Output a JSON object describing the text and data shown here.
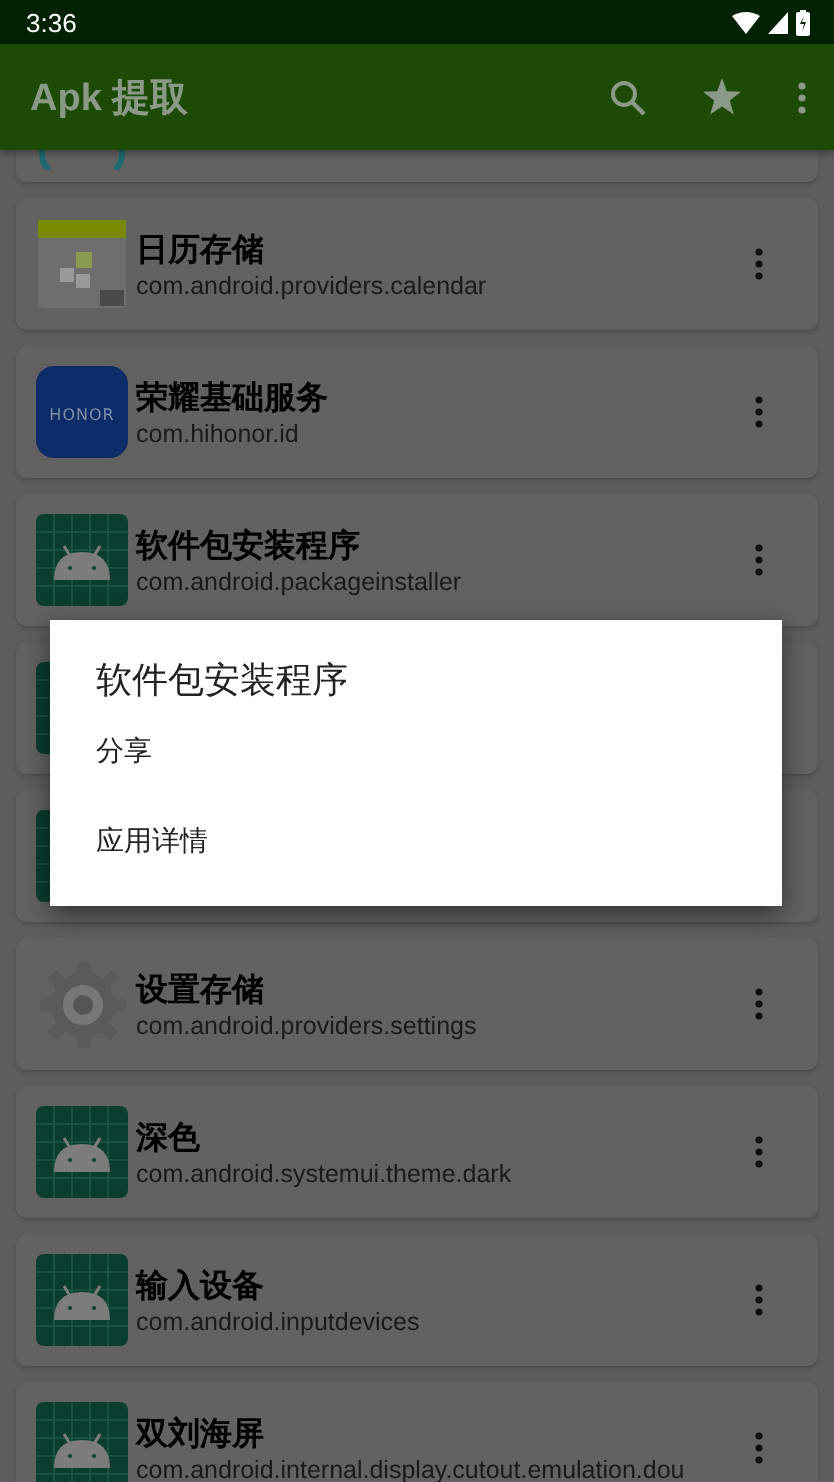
{
  "status_bar": {
    "time": "3:36"
  },
  "app_bar": {
    "title": "Apk 提取"
  },
  "apps": [
    {
      "kind": "partial"
    },
    {
      "kind": "calendar",
      "name": "日历存储",
      "package": "com.android.providers.calendar"
    },
    {
      "kind": "logo",
      "icon_text": "HONOR",
      "name": "荣耀基础服务",
      "package": "com.hihonor.id"
    },
    {
      "kind": "android",
      "name": "软件包安装程序",
      "package": "com.android.packageinstaller"
    },
    {
      "kind": "android"
    },
    {
      "kind": "android"
    },
    {
      "kind": "gear",
      "name": "设置存储",
      "package": "com.android.providers.settings"
    },
    {
      "kind": "android",
      "name": "深色",
      "package": "com.android.systemui.theme.dark"
    },
    {
      "kind": "android",
      "name": "输入设备",
      "package": "com.android.inputdevices"
    },
    {
      "kind": "android",
      "name": "双刘海屏",
      "package": "com.android.internal.display.cutout.emulation.dou"
    }
  ],
  "dialog": {
    "title": "软件包安装程序",
    "items": [
      "分享",
      "应用详情"
    ]
  }
}
